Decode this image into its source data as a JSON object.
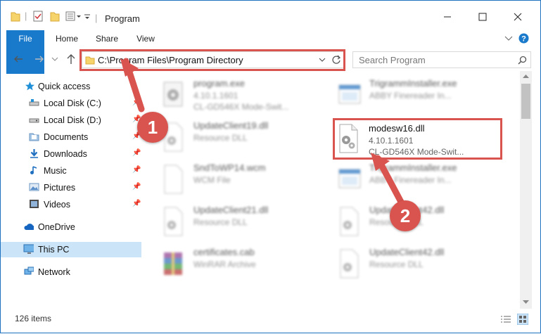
{
  "window": {
    "title": "Program"
  },
  "ribbon": {
    "tabs": [
      "File",
      "Home",
      "Share",
      "View"
    ]
  },
  "address": {
    "path": "C:\\Program Files\\Program Directory"
  },
  "search": {
    "placeholder": "Search Program"
  },
  "sidebar": {
    "items": [
      {
        "label": "Quick access",
        "icon": "star-icon"
      },
      {
        "label": "Local Disk (C:)",
        "icon": "drive-icon",
        "pinned": true
      },
      {
        "label": "Local Disk (D:)",
        "icon": "drive-icon",
        "pinned": true
      },
      {
        "label": "Documents",
        "icon": "documents-icon",
        "pinned": true
      },
      {
        "label": "Downloads",
        "icon": "download-icon",
        "pinned": true
      },
      {
        "label": "Music",
        "icon": "music-icon",
        "pinned": true
      },
      {
        "label": "Pictures",
        "icon": "pictures-icon",
        "pinned": true
      },
      {
        "label": "Videos",
        "icon": "videos-icon",
        "pinned": true
      },
      {
        "label": "OneDrive",
        "icon": "cloud-icon"
      },
      {
        "label": "This PC",
        "icon": "computer-icon",
        "selected": true
      },
      {
        "label": "Network",
        "icon": "network-icon"
      }
    ]
  },
  "files": [
    {
      "name": "program.exe",
      "line1": "4.10.1.1601",
      "line2": "CL-GD546X Mode-Swit...",
      "type": "exe"
    },
    {
      "name": "TrigrammInstaller.exe",
      "line1": "ABBY Finereader In...",
      "line2": "",
      "type": "installer"
    },
    {
      "name": "UpdateClient19.dll",
      "line1": "Resource DLL",
      "line2": "",
      "type": "dll"
    },
    {
      "name": "modesw16.dll",
      "line1": "4.10.1.1601",
      "line2": "CL-GD546X Mode-Swit...",
      "type": "dll",
      "highlighted": true
    },
    {
      "name": "SndToWP14.wcm",
      "line1": "WCM File",
      "line2": "",
      "type": "blank"
    },
    {
      "name": "TrigrammInstaller.exe",
      "line1": "ABBY Finereader In...",
      "line2": "",
      "type": "installer"
    },
    {
      "name": "UpdateClient21.dll",
      "line1": "Resource DLL",
      "line2": "",
      "type": "dll"
    },
    {
      "name": "UpdateClient42.dll",
      "line1": "Resource DLL",
      "line2": "",
      "type": "dll"
    },
    {
      "name": "certificates.cab",
      "line1": "WinRAR Archive",
      "line2": "",
      "type": "archive"
    },
    {
      "name": "UpdateClient42.dll",
      "line1": "Resource DLL",
      "line2": "",
      "type": "dll"
    }
  ],
  "status": {
    "items": "126 items"
  },
  "callouts": [
    "1",
    "2"
  ],
  "colors": {
    "accent": "#1979ca",
    "highlight": "#d9534f",
    "selected": "#cce4f7"
  }
}
